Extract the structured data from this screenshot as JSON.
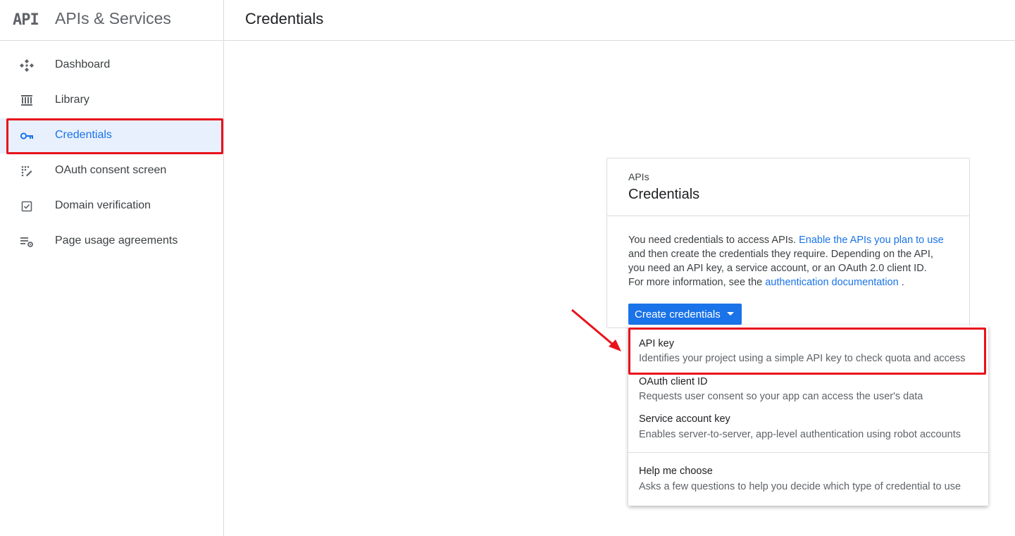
{
  "header": {
    "logo_text": "API",
    "product_title": "APIs & Services",
    "page_title": "Credentials"
  },
  "sidebar": {
    "items": [
      {
        "label": "Dashboard",
        "icon": "dashboard-icon",
        "active": false
      },
      {
        "label": "Library",
        "icon": "library-icon",
        "active": false
      },
      {
        "label": "Credentials",
        "icon": "key-icon",
        "active": true
      },
      {
        "label": "OAuth consent screen",
        "icon": "oauth-consent-icon",
        "active": false
      },
      {
        "label": "Domain verification",
        "icon": "checkbox-icon",
        "active": false
      },
      {
        "label": "Page usage agreements",
        "icon": "settings-list-icon",
        "active": false
      }
    ]
  },
  "card": {
    "overline": "APIs",
    "title": "Credentials",
    "body_part1": "You need credentials to access APIs. ",
    "link1": "Enable the APIs you plan to use",
    "body_part2": " and then create the credentials they require. Depending on the API, you need an API key, a service account, or an OAuth 2.0 client ID. For more information, see the ",
    "link2": "authentication documentation",
    "body_part3": " ."
  },
  "create_button": {
    "label": "Create credentials"
  },
  "menu": {
    "items": [
      {
        "title": "API key",
        "description": "Identifies your project using a simple API key to check quota and access"
      },
      {
        "title": "OAuth client ID",
        "description": "Requests user consent so your app can access the user's data"
      },
      {
        "title": "Service account key",
        "description": "Enables server-to-server, app-level authentication using robot accounts"
      },
      {
        "title": "Help me choose",
        "description": "Asks a few questions to help you decide which type of credential to use"
      }
    ]
  },
  "colors": {
    "accent": "#1a73e8",
    "annotation_red": "#e8121b",
    "active_bg": "#e8f0fe"
  }
}
